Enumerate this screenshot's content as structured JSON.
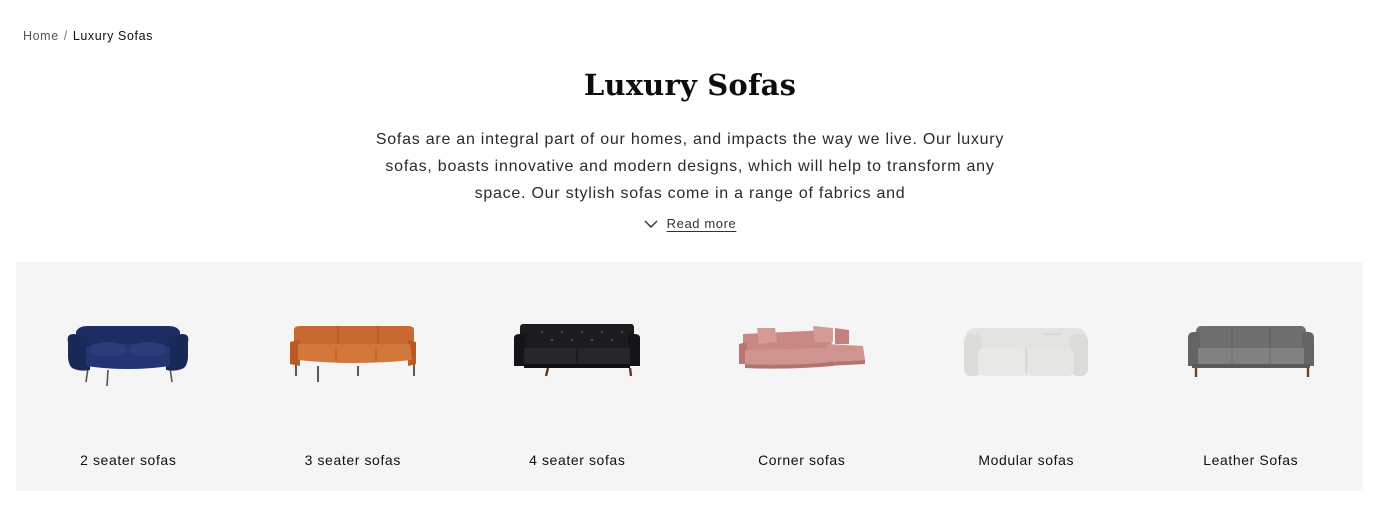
{
  "breadcrumb": {
    "home": "Home",
    "separator": "/",
    "current": "Luxury Sofas"
  },
  "page": {
    "title": "Luxury Sofas",
    "intro": "Sofas are an integral part of our homes, and impacts the way we live. Our luxury sofas, boasts innovative and modern designs, which will help to transform any space. Our stylish sofas come in a range of fabrics and",
    "read_more": "Read more"
  },
  "categories": [
    {
      "label": "2 seater sofas",
      "icon": "navy-2-seater-sofa-image",
      "color": "#1b2a5c"
    },
    {
      "label": "3 seater sofas",
      "icon": "tan-3-seater-sofa-image",
      "color": "#c0622a"
    },
    {
      "label": "4 seater sofas",
      "icon": "black-leather-4-seater-sofa-image",
      "color": "#1c1c1f"
    },
    {
      "label": "Corner sofas",
      "icon": "pink-corner-sofa-image",
      "color": "#c98b86"
    },
    {
      "label": "Modular sofas",
      "icon": "grey-modular-sofa-image",
      "color": "#dcdcdc"
    },
    {
      "label": "Leather Sofas",
      "icon": "grey-leather-sofa-image",
      "color": "#77777a"
    }
  ],
  "colors": {
    "background": "#ffffff",
    "panel": "#f5f5f5",
    "text": "#111111"
  }
}
